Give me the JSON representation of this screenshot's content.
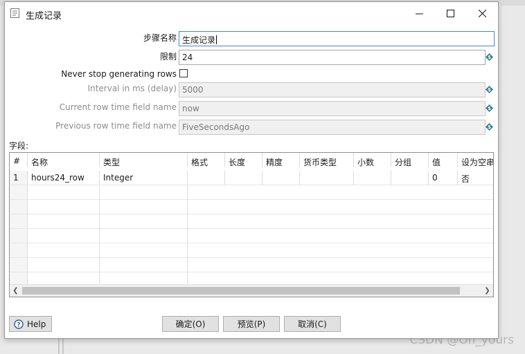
{
  "background": {
    "watermark": "CSDN @Oh_yours"
  },
  "dialog": {
    "title": "生成记录",
    "window_controls": {
      "minimize_icon": "minimize-icon",
      "maximize_icon": "maximize-icon",
      "close_icon": "close-icon"
    },
    "form": {
      "step_name_label": "步骤名称",
      "step_name_value": "生成记录",
      "limit_label": "限制",
      "limit_value": "24",
      "never_stop_label": "Never stop generating rows",
      "never_stop_checked": false,
      "interval_label": "Interval in ms (delay)",
      "interval_value": "5000",
      "current_time_label": "Current row time field name",
      "current_time_value": "now",
      "previous_time_label": "Previous row time field name",
      "previous_time_value": "FiveSecondsAgo",
      "variable_icon": "variable-dollar-icon"
    },
    "fields": {
      "section_label": "字段:",
      "columns": [
        "#",
        "名称",
        "类型",
        "格式",
        "长度",
        "精度",
        "货币类型",
        "小数",
        "分组",
        "值",
        "设为空串"
      ],
      "rows": [
        [
          "1",
          "hours24_row",
          "Integer",
          "",
          "",
          "",
          "",
          "",
          "",
          "0",
          "否"
        ]
      ]
    },
    "buttons": {
      "help": "Help",
      "ok": "确定(O)",
      "preview": "预览(P)",
      "cancel": "取消(C)"
    },
    "colors": {
      "focus_border": "#3d87d6",
      "variable_icon": "#2d7d8c"
    }
  }
}
